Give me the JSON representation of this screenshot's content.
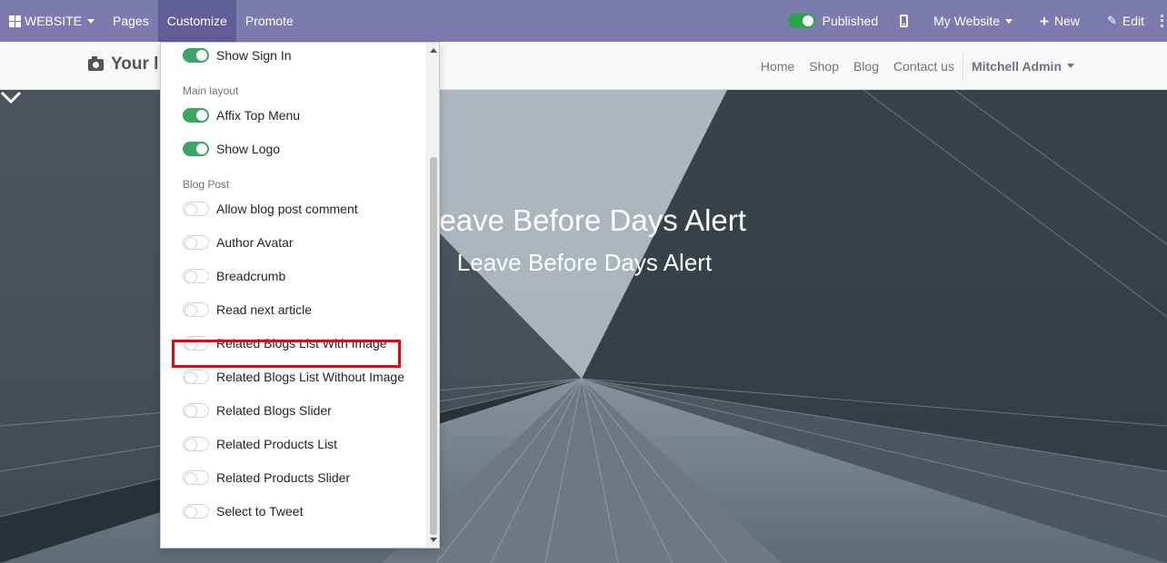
{
  "topbar": {
    "brand": "WEBSITE",
    "menu": [
      "Pages",
      "Customize",
      "Promote"
    ],
    "published_label": "Published",
    "website_label": "My Website",
    "new_label": "New",
    "edit_label": "Edit"
  },
  "site": {
    "logo_text": "Your l",
    "nav": [
      "Home",
      "Shop",
      "Blog",
      "Contact us"
    ],
    "user": "Mitchell Admin"
  },
  "hero": {
    "title": "Leave Before Days Alert",
    "subtitle": "Leave Before Days Alert"
  },
  "customize_menu": {
    "items": [
      {
        "label": "Show Sign In",
        "on": true
      },
      {
        "header": "Main layout"
      },
      {
        "label": "Affix Top Menu",
        "on": true
      },
      {
        "label": "Show Logo",
        "on": true
      },
      {
        "header": "Blog Post"
      },
      {
        "label": "Allow blog post comment",
        "on": false
      },
      {
        "label": "Author Avatar",
        "on": false
      },
      {
        "label": "Breadcrumb",
        "on": false
      },
      {
        "label": "Read next article",
        "on": false
      },
      {
        "label": "Related Blogs List With Image",
        "on": false
      },
      {
        "label": "Related Blogs List Without Image",
        "on": false
      },
      {
        "label": "Related Blogs Slider",
        "on": false
      },
      {
        "label": "Related Products List",
        "on": false
      },
      {
        "label": "Related Products Slider",
        "on": false
      },
      {
        "label": "Select to Tweet",
        "on": false
      }
    ]
  },
  "colors": {
    "topbar": "#7c7bad",
    "topbar_active": "#5f5e97",
    "toggle_on": "#3aa565",
    "highlight": "#e30613"
  }
}
